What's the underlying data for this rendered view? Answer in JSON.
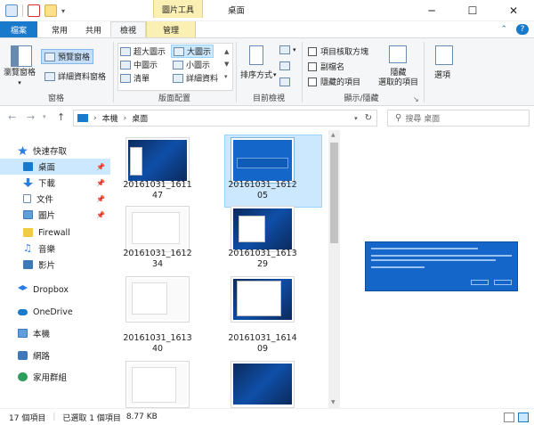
{
  "window": {
    "title": "桌面",
    "context_tab_header": "圖片工具",
    "minimize": "─",
    "maximize": "☐",
    "close": "✕",
    "help": "?"
  },
  "tabs": [
    {
      "label": "檔案"
    },
    {
      "label": "常用"
    },
    {
      "label": "共用"
    },
    {
      "label": "檢視"
    },
    {
      "label": "管理"
    }
  ],
  "ribbon": {
    "panes": {
      "nav_pane": "瀏覽窗格",
      "preview_pane": "預覽窗格",
      "details_pane": "詳細資料窗格",
      "label": "窗格"
    },
    "layout": {
      "items": [
        "超大圖示",
        "大圖示",
        "中圖示",
        "小圖示",
        "清單",
        "詳細資料"
      ],
      "label": "版面配置"
    },
    "current_view": {
      "sort": "排序方式",
      "label": "目前檢視"
    },
    "show_hide": {
      "item_checkboxes": "項目核取方塊",
      "file_ext": "副檔名",
      "hidden_items": "隱藏的項目",
      "hide_selected_1": "隱藏",
      "hide_selected_2": "選取的項目",
      "label": "顯示/隱藏"
    },
    "options": "選項"
  },
  "address": {
    "path": [
      "本機",
      "桌面"
    ],
    "sep": "›",
    "search_placeholder": "搜尋 桌面"
  },
  "nav": {
    "items": [
      {
        "label": "快速存取"
      },
      {
        "label": "桌面"
      },
      {
        "label": "下載"
      },
      {
        "label": "文件"
      },
      {
        "label": "圖片"
      },
      {
        "label": "Firewall"
      },
      {
        "label": "音樂"
      },
      {
        "label": "影片"
      },
      {
        "label": "Dropbox"
      },
      {
        "label": "OneDrive"
      },
      {
        "label": "本機"
      },
      {
        "label": "網路"
      },
      {
        "label": "家用群組"
      }
    ]
  },
  "files": [
    {
      "line1": "20161031_1611",
      "line2": "47"
    },
    {
      "line1": "20161031_1612",
      "line2": "05"
    },
    {
      "line1": "20161031_1612",
      "line2": "34"
    },
    {
      "line1": "20161031_1613",
      "line2": "29"
    },
    {
      "line1": "20161031_1613",
      "line2": "40"
    },
    {
      "line1": "20161031_1614",
      "line2": "09"
    }
  ],
  "status": {
    "count": "17 個項目",
    "selected": "已選取 1 個項目",
    "size": "8.77 KB"
  },
  "colors": {
    "accent": "#1979ca",
    "selection": "#cce8ff",
    "context": "#fbf0b4"
  }
}
